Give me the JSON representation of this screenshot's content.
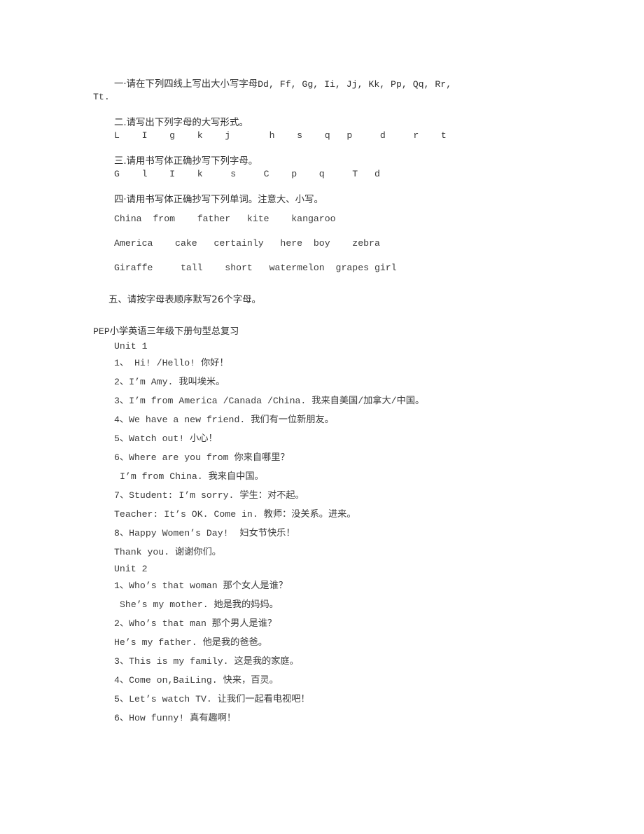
{
  "document": {
    "exercises": [
      {
        "id": "section-one",
        "heading_cn": "一·请在下列四线上写出大小写字母",
        "heading_en_inline": "Dd, Ff, Gg, Ii, Jj, Kk, Pp, Qq, Rr,",
        "wrap_line": "Tt."
      },
      {
        "id": "section-two",
        "heading": "二.请写出下列字母的大写形式。",
        "content": "L    I    g    k    j       h    s    q   p     d     r    t"
      },
      {
        "id": "section-three",
        "heading": "三.请用书写体正确抄写下列字母。",
        "content": "G    l    I    k     s     C    p    q     T   d"
      },
      {
        "id": "section-four",
        "heading": "四·请用书写体正确抄写下列单词。注意大、小写。",
        "rows": [
          "China  from    father   kite    kangaroo",
          "America    cake   certainly   here  boy    zebra",
          "Giraffe     tall    short   watermelon  grapes girl"
        ]
      },
      {
        "id": "section-five",
        "heading": "五、请按字母表顺序默写26个字母。"
      }
    ],
    "review_title": "PEP小学英语三年级下册句型总复习",
    "units": [
      {
        "label": "Unit 1",
        "lines": [
          {
            "type": "numbered",
            "text": "1、 Hi! /Hello! 你好！"
          },
          {
            "type": "numbered",
            "text": "2、I’m Amy. 我叫埃米。"
          },
          {
            "type": "numbered",
            "text": "3、I’m from America /Canada /China. 我来自美国/加拿大/中国。"
          },
          {
            "type": "numbered",
            "text": "4、We have a new friend. 我们有一位新朋友。"
          },
          {
            "type": "numbered",
            "text": "5、Watch out! 小心！"
          },
          {
            "type": "numbered",
            "text": "6、Where are you from 你来自哪里？"
          },
          {
            "type": "sub",
            "text": "I’m from China. 我来自中国。"
          },
          {
            "type": "numbered",
            "text": "7、Student: I’m sorry. 学生：对不起。"
          },
          {
            "type": "cont",
            "text": "Teacher: It’s OK. Come in. 教师：没关系。进来。"
          },
          {
            "type": "numbered",
            "text": "8、Happy Women’s Day!  妇女节快乐！"
          },
          {
            "type": "cont",
            "text": "Thank you. 谢谢你们。"
          }
        ]
      },
      {
        "label": "Unit 2",
        "lines": [
          {
            "type": "numbered",
            "text": "1、Who’s that woman 那个女人是谁？"
          },
          {
            "type": "sub",
            "text": "She’s my mother. 她是我的妈妈。"
          },
          {
            "type": "numbered",
            "text": "2、Who’s that man 那个男人是谁？"
          },
          {
            "type": "cont",
            "text": "He’s my father. 他是我的爸爸。"
          },
          {
            "type": "numbered",
            "text": "3、This is my family. 这是我的家庭。"
          },
          {
            "type": "numbered",
            "text": "4、Come on,BaiLing. 快来，百灵。"
          },
          {
            "type": "numbered",
            "text": "5、Let’s watch TV. 让我们一起看电视吧！"
          },
          {
            "type": "numbered",
            "text": "6、How funny! 真有趣啊！"
          }
        ]
      }
    ]
  },
  "colors": {
    "page_background": "#ffffff",
    "text": "#3a3a3a"
  }
}
